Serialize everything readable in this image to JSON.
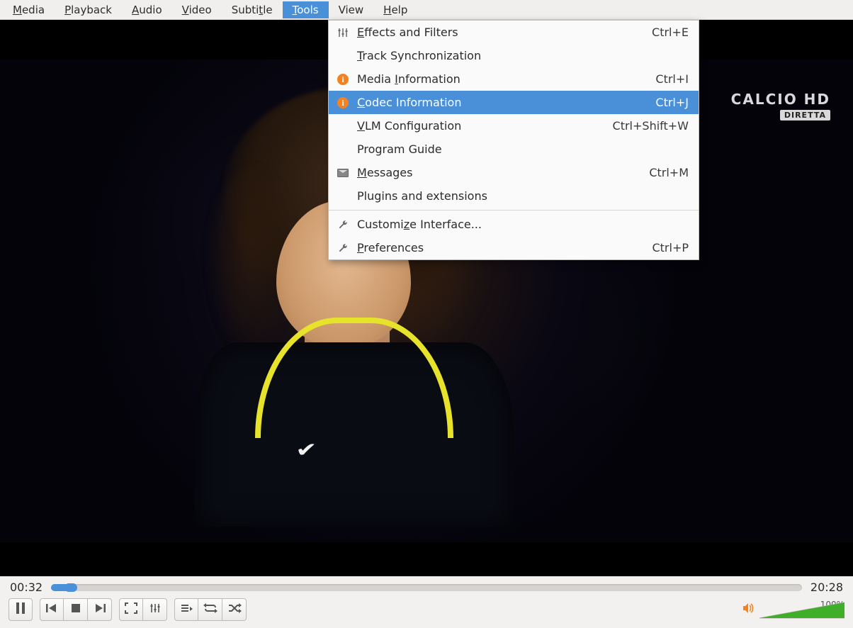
{
  "menubar": {
    "items": [
      {
        "label": "Media",
        "u": 0
      },
      {
        "label": "Playback",
        "u": 0
      },
      {
        "label": "Audio",
        "u": 0
      },
      {
        "label": "Video",
        "u": 0
      },
      {
        "label": "Subtitle",
        "u": 5
      },
      {
        "label": "Tools",
        "u": 0
      },
      {
        "label": "View",
        "u": -1
      },
      {
        "label": "Help",
        "u": 0
      }
    ],
    "active_index": 5
  },
  "tools_menu": [
    {
      "type": "item",
      "icon": "sliders",
      "label": "Effects and Filters",
      "u": 0,
      "accel": "Ctrl+E"
    },
    {
      "type": "item",
      "icon": "",
      "label": "Track Synchronization",
      "u": 0,
      "accel": ""
    },
    {
      "type": "item",
      "icon": "info",
      "label": "Media Information",
      "u": 6,
      "accel": "Ctrl+I"
    },
    {
      "type": "item",
      "icon": "info",
      "label": "Codec Information",
      "u": 0,
      "accel": "Ctrl+J",
      "highlight": true
    },
    {
      "type": "item",
      "icon": "",
      "label": "VLM Configuration",
      "u": 0,
      "accel": "Ctrl+Shift+W"
    },
    {
      "type": "item",
      "icon": "",
      "label": "Program Guide",
      "u": -1,
      "accel": ""
    },
    {
      "type": "item",
      "icon": "msg",
      "label": "Messages",
      "u": 0,
      "accel": "Ctrl+M"
    },
    {
      "type": "item",
      "icon": "",
      "label": "Plugins and extensions",
      "u": -1,
      "accel": ""
    },
    {
      "type": "sep"
    },
    {
      "type": "item",
      "icon": "wrench",
      "label": "Customize Interface...",
      "u": 7,
      "accel": ""
    },
    {
      "type": "item",
      "icon": "wrench",
      "label": "Preferences",
      "u": 0,
      "accel": "Ctrl+P"
    }
  ],
  "broadcast": {
    "line1": "CALCIO HD",
    "line2": "DIRETTA"
  },
  "playback": {
    "elapsed": "00:32",
    "total": "20:28",
    "progress_pct": 2.6
  },
  "volume": {
    "pct_label": "100%",
    "pct": 100
  },
  "control_groups": [
    {
      "name": "play",
      "buttons": [
        {
          "name": "pause-button",
          "icon": "pause"
        }
      ]
    },
    {
      "name": "nav",
      "buttons": [
        {
          "name": "prev-button",
          "icon": "prev"
        },
        {
          "name": "stop-button",
          "icon": "stop"
        },
        {
          "name": "next-button",
          "icon": "next"
        }
      ]
    },
    {
      "name": "view",
      "buttons": [
        {
          "name": "fullscreen-button",
          "icon": "fullscreen"
        },
        {
          "name": "ext-settings-button",
          "icon": "ext-sliders"
        }
      ]
    },
    {
      "name": "playlist",
      "buttons": [
        {
          "name": "playlist-button",
          "icon": "playlist"
        },
        {
          "name": "loop-button",
          "icon": "loop"
        },
        {
          "name": "shuffle-button",
          "icon": "shuffle"
        }
      ]
    }
  ]
}
